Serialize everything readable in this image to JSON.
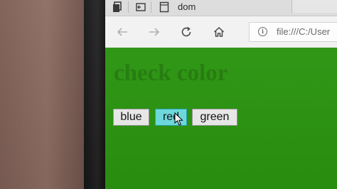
{
  "browser": {
    "tab_title": "dom",
    "address_url": "file:///C:/User"
  },
  "page": {
    "heading": "check color",
    "buttons": [
      {
        "label": "blue"
      },
      {
        "label": "red"
      },
      {
        "label": "green"
      }
    ],
    "background_color": "#2b9610",
    "hovered_button_color": "#6fe0e3"
  },
  "icons": {
    "tab_actions": "copy-icon",
    "tab_restore": "tab-restore-icon",
    "page": "page-icon",
    "back": "back-arrow-icon",
    "forward": "forward-arrow-icon",
    "refresh": "refresh-icon",
    "home": "home-icon",
    "info": "info-icon",
    "cursor": "mouse-cursor-icon"
  }
}
